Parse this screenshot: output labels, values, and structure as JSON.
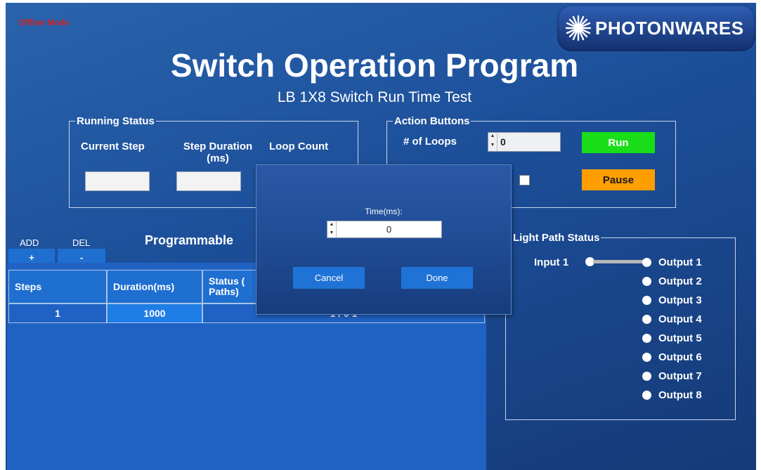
{
  "app": {
    "offline_mode": "Offline Mode",
    "logo_text": "PHOTONWARES",
    "title": "Switch Operation Program",
    "subtitle": "LB 1X8 Switch Run Time Test"
  },
  "running_status": {
    "legend": "Running Status",
    "current_step_label": "Current Step",
    "step_duration_label_line1": "Step Duration",
    "step_duration_label_line2": "(ms)",
    "loop_count_label": "Loop Count",
    "current_step_value": "",
    "step_duration_value": ""
  },
  "action_buttons": {
    "legend": "Action Buttons",
    "loops_label": "# of Loops",
    "loops_value": "0",
    "run_label": "Run",
    "pause_label": "Pause",
    "run_color": "#19dd19",
    "pause_color": "#ff9e00"
  },
  "programmable": {
    "title": "Programmable",
    "add_label": "ADD",
    "add_button": "+",
    "del_label": "DEL",
    "del_button": "-",
    "columns": [
      "Steps",
      "Duration(ms)",
      "Status (",
      "Paths)"
    ],
    "rows": [
      {
        "step": "1",
        "duration": "1000",
        "status": "1 / 0 1"
      }
    ]
  },
  "light_path": {
    "legend": "Light Path Status",
    "input_label": "Input 1",
    "outputs": [
      "Output 1",
      "Output 2",
      "Output 3",
      "Output 4",
      "Output 5",
      "Output 6",
      "Output 7",
      "Output 8"
    ],
    "connected_output": "Output 1"
  },
  "dialog": {
    "time_label": "Time(ms):",
    "time_value": "0",
    "cancel_label": "Cancel",
    "done_label": "Done"
  }
}
